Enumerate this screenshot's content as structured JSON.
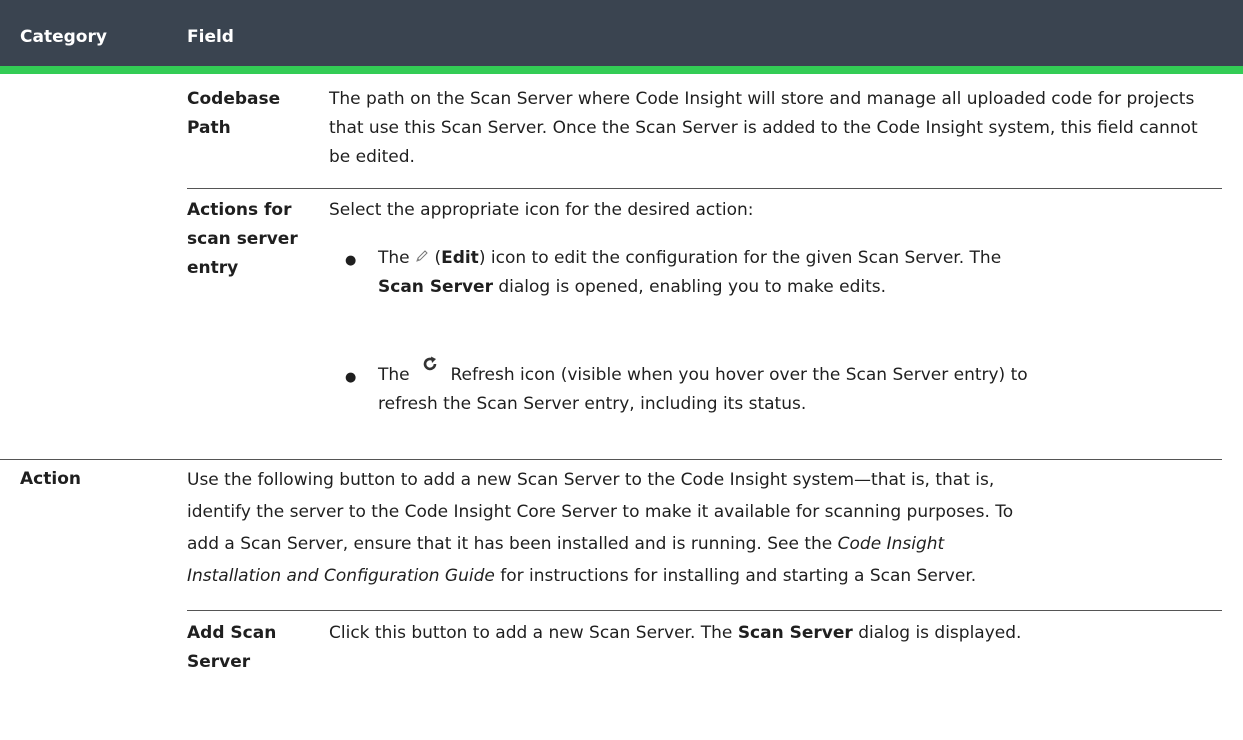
{
  "header": {
    "category": "Category",
    "field": "Field"
  },
  "rows": {
    "codebase": {
      "field": "Codebase Path",
      "desc": "The path on the Scan Server where Code Insight will store and manage all uploaded code for projects that use this Scan Server. Once the Scan Server is added to the Code Insight system, this field cannot be edited."
    },
    "actions": {
      "field_line1": "Actions for",
      "field_line2": "scan server",
      "field_line3": "entry",
      "intro": "Select the appropriate icon for the desired action:",
      "bullet1": {
        "pre": "The",
        "paren_open": "(",
        "edit_bold": "Edit",
        "paren_close": ")",
        "rest1": "icon to edit the configuration for the given Scan Server. The",
        "bold2": "Scan Server",
        "rest2": "dialog is opened, enabling you to make edits."
      },
      "bullet2": {
        "pre": "The",
        "rest1": "Refresh icon (visible when you hover over the Scan Server entry) to",
        "rest2": "refresh the Scan Server entry, including its status."
      }
    },
    "action": {
      "category": "Action",
      "line1": "Use the following button to add a new Scan Server to the Code Insight system—that is, that is,",
      "line2": "identify the server to the Code Insight Core Server to make it available for scanning purposes. To",
      "line3": "add a Scan Server, ensure that it has been installed and is running. See the",
      "line3_italic": "Code Insight",
      "line4_italic": "Installation and Configuration Guide",
      "line4": "for instructions for installing and starting a Scan Server."
    },
    "add": {
      "field_line1": "Add Scan",
      "field_line2": "Server",
      "pre": "Click this button to add a new Scan Server. The",
      "bold": "Scan Server",
      "post": "dialog is displayed."
    }
  },
  "icons": {
    "edit": "pencil-icon",
    "refresh": "refresh-icon"
  },
  "colors": {
    "header_bg": "#3a4450",
    "accent": "#33cc55"
  }
}
